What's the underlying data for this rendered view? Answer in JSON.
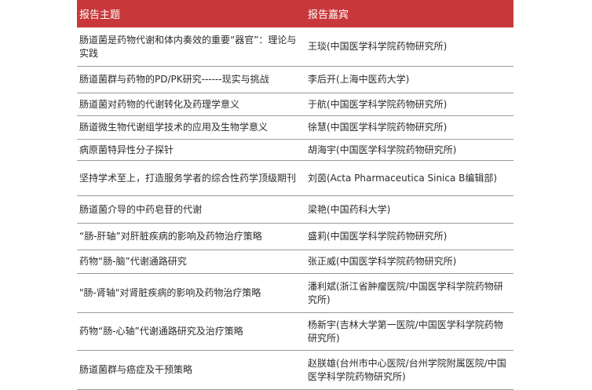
{
  "header": {
    "topic_label": "报告主题",
    "speaker_label": "报告嘉宾"
  },
  "rows": [
    {
      "topic": "肠道菌是药物代谢和体内奏效的重要“器官”：理论与实践",
      "speaker": "王琰(中国医学科学院药物研究所)"
    },
    {
      "topic": "肠道菌群与药物的PD/PK研究------现实与挑战",
      "speaker": "李后开(上海中医药大学)"
    },
    {
      "topic": "肠道菌对药物的代谢转化及药理学意义",
      "speaker": "于航(中国医学科学院药物研究所)"
    },
    {
      "topic": "肠道微生物代谢组学技术的应用及生物学意义",
      "speaker": "徐慧(中国医学科学院药物研究所)"
    },
    {
      "topic": "病原菌特异性分子探针",
      "speaker": "胡海宇(中国医学科学院药物研究所)"
    },
    {
      "topic": "坚持学术至上，打造服务学者的综合性药学顶级期刊",
      "speaker": "刘茵(Acta Pharmaceutica Sinica B编辑部)"
    },
    {
      "topic": "肠道菌介导的中药皂苷的代谢",
      "speaker": "梁艳(中国药科大学)"
    },
    {
      "topic": "“肠-肝轴”对肝脏疾病的影响及药物治疗策略",
      "speaker": "盛莉(中国医学科学院药物研究所)"
    },
    {
      "topic": "药物“肠-脑”代谢通路研究",
      "speaker": "张正威(中国医学科学院药物研究所)"
    },
    {
      "topic": "\"肠-肾轴\"对肾脏疾病的影响及药物治疗策略",
      "speaker": "潘利斌(浙江省肿瘤医院/中国医学科学院药物研究所)"
    },
    {
      "topic": "药物“肠-心轴”代谢通路研究及治疗策略",
      "speaker": "杨新宇(吉林大学第一医院/中国医学科学院药物研究所)"
    },
    {
      "topic": "肠道菌群与癌症及干预策略",
      "speaker": "赵朕雄(台州市中心医院/台州学院附属医院/中国医学科学院药物研究所)"
    }
  ]
}
